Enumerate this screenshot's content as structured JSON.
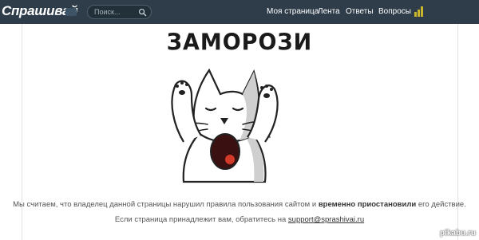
{
  "header": {
    "brand": "Спрашивай",
    "search_placeholder": "Поиск...",
    "nav": [
      "Моя страница",
      "Лента",
      "Ответы",
      "Вопросы"
    ],
    "bg_color": "#2f3d4a"
  },
  "main": {
    "headline": "ЗАМОРОЗИ",
    "line1_start": "Мы считаем, что владелец данной страницы нарушил правила пользования сайтом и ",
    "line1_bold": "временно приостановили",
    "line1_end": " его действие.",
    "line2_start": "Если страница принадлежит вам, обратитесь на ",
    "line2_link": "support@sprashivai.ru"
  },
  "watermark": "pikabu.ru",
  "icons": [
    "search-icon",
    "stats-bars-icon",
    "screaming-cat-illustration"
  ]
}
